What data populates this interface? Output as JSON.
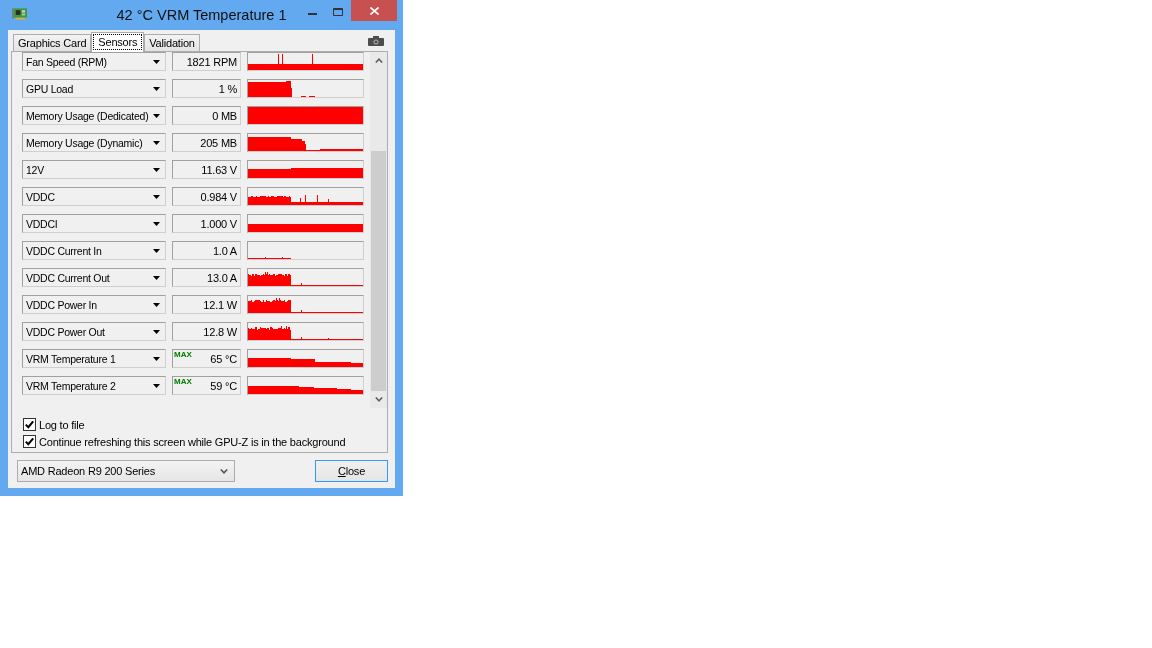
{
  "window": {
    "title": "42 °C VRM Temperature 1"
  },
  "tabs": [
    {
      "label": "Graphics Card",
      "selected": false
    },
    {
      "label": "Sensors",
      "selected": true
    },
    {
      "label": "Validation",
      "selected": false
    }
  ],
  "sensors": [
    {
      "name": "Fan Speed (RPM)",
      "value": "1821 RPM"
    },
    {
      "name": "GPU Load",
      "value": "1 %"
    },
    {
      "name": "Memory Usage (Dedicated)",
      "value": "0 MB"
    },
    {
      "name": "Memory Usage (Dynamic)",
      "value": "205 MB"
    },
    {
      "name": "12V",
      "value": "11.63 V"
    },
    {
      "name": "VDDC",
      "value": "0.984 V"
    },
    {
      "name": "VDDCI",
      "value": "1.000 V"
    },
    {
      "name": "VDDC Current In",
      "value": "1.0 A"
    },
    {
      "name": "VDDC Current Out",
      "value": "13.0 A"
    },
    {
      "name": "VDDC Power In",
      "value": "12.1 W"
    },
    {
      "name": "VDDC Power Out",
      "value": "12.8 W"
    },
    {
      "name": "VRM Temperature 1",
      "badge": "MAX",
      "value": "65 °C"
    },
    {
      "name": "VRM Temperature 2",
      "badge": "MAX",
      "value": "59 °C"
    }
  ],
  "options": [
    {
      "label": "Log to file",
      "checked": true
    },
    {
      "label": "Continue refreshing this screen while GPU-Z is in the background",
      "checked": true
    }
  ],
  "device_select": {
    "value": "AMD Radeon R9 200 Series"
  },
  "close_button": {
    "label": "Close",
    "focused": true
  }
}
